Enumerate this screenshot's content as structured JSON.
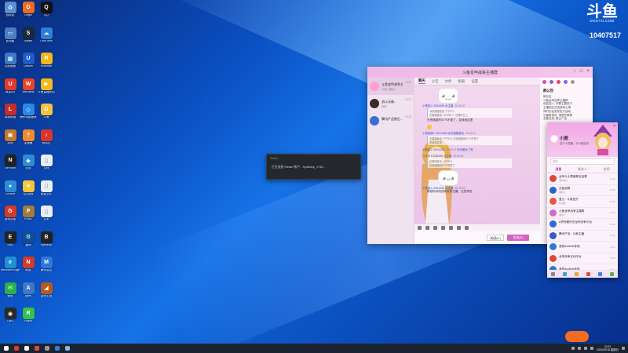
{
  "brand": {
    "logo": "斗鱼",
    "logo_sub": "DOUYU.COM",
    "room_id": "10407517",
    "accent": "#f36b20"
  },
  "desktop_icons": [
    {
      "label": "回收站",
      "color": "#5b8fd1",
      "glyph": "♻"
    },
    {
      "label": "Origin",
      "color": "#f06a1f",
      "glyph": "O"
    },
    {
      "label": "QQ",
      "color": "#111",
      "glyph": "Q"
    },
    {
      "label": "此电脑",
      "color": "#4b7fc2",
      "glyph": "▭"
    },
    {
      "label": "Steam",
      "color": "#1b2838",
      "glyph": "S"
    },
    {
      "label": "OneDrive",
      "color": "#2d7fd6",
      "glyph": "☁"
    },
    {
      "label": "控制面板",
      "color": "#3a78c8",
      "glyph": "▦"
    },
    {
      "label": "Ubisoft",
      "color": "#1d5cc7",
      "glyph": "U"
    },
    {
      "label": "Rockstar",
      "color": "#f1b61c",
      "glyph": "R"
    },
    {
      "label": "网易UU",
      "color": "#e23b2f",
      "glyph": "U"
    },
    {
      "label": "WeGame",
      "color": "#e8442a",
      "glyph": "W"
    },
    {
      "label": "斗鱼直播伴侣",
      "color": "#f4b81e",
      "glyph": "▶"
    },
    {
      "label": "英雄联盟",
      "color": "#c62c2c",
      "glyph": "L"
    },
    {
      "label": "腾讯电脑管家",
      "color": "#2a88e8",
      "glyph": "◇"
    },
    {
      "label": "斗鱼",
      "color": "#f6c23a",
      "glyph": "D"
    },
    {
      "label": "游戏",
      "color": "#c47a2b",
      "glyph": "▣"
    },
    {
      "label": "加速器",
      "color": "#f28a2b",
      "glyph": "?"
    },
    {
      "label": "网易云",
      "color": "#d9362b",
      "glyph": "♪"
    },
    {
      "label": "GeForce",
      "color": "#222",
      "glyph": "N"
    },
    {
      "label": "应用",
      "color": "#2f8bd6",
      "glyph": "◆"
    },
    {
      "label": "文档",
      "color": "#e9eef5",
      "glyph": "▯"
    },
    {
      "label": "Chrome",
      "color": "#2f8bd6",
      "glyph": "●"
    },
    {
      "label": "QQ游戏",
      "color": "#f6c73a",
      "glyph": "★"
    },
    {
      "label": "新建文件",
      "color": "#e9eef5",
      "glyph": "▯"
    },
    {
      "label": "游戏加加",
      "color": "#d33a2a",
      "glyph": "G"
    },
    {
      "label": "PUBG",
      "color": "#a47b3a",
      "glyph": "P"
    },
    {
      "label": "文本",
      "color": "#e9eef5",
      "glyph": "▯"
    },
    {
      "label": "Epic",
      "color": "#222",
      "glyph": "E"
    },
    {
      "label": "雷神",
      "color": "#0e4e94",
      "glyph": "⚙"
    },
    {
      "label": "Bandizip",
      "color": "#222",
      "glyph": "B"
    },
    {
      "label": "Microsoft Edge",
      "color": "#1f8fd6",
      "glyph": "e"
    },
    {
      "label": "网易",
      "color": "#d33a2a",
      "glyph": "N"
    },
    {
      "label": "腾讯会议",
      "color": "#2f78d8",
      "glyph": "M"
    },
    {
      "label": "微信",
      "color": "#2bb14b",
      "glyph": "✉"
    },
    {
      "label": "Apex",
      "color": "#4176c8",
      "glyph": "A"
    },
    {
      "label": "游戏平台",
      "color": "#b85a1e",
      "glyph": "◢"
    },
    {
      "label": "OBS",
      "color": "#2a2a2a",
      "glyph": "◉"
    },
    {
      "label": "Razer",
      "color": "#33c24a",
      "glyph": "R"
    }
  ],
  "steam_popup": {
    "title": "Steam",
    "message": "正在连接 Steam 帐户：bydsktop_1745..."
  },
  "qq_window": {
    "title": "斗鱼龙甲战争主播群",
    "conversations": [
      {
        "name": "斗鱼龙甲战争主...",
        "preview": "斗鱼: [图片]",
        "time": "20:49"
      },
      {
        "name": "战斗无敌...",
        "preview": "你好",
        "time": "19:21"
      },
      {
        "name": "腾讯产品售后...",
        "preview": "...",
        "time": "15:30"
      }
    ],
    "tabs": [
      "聊天",
      "公告",
      "文件",
      "相册",
      "设置"
    ],
    "messages": [
      {
        "from": "小黑鲨1 10914455",
        "tag": "@主播",
        "time": "20:45:37",
        "quote": [
          "@陈路路昔吞 宁宁ff+1",
          "在路路昔吞: 2015年了, 仿佛昨日上"
        ],
        "text": "白夜路路的5775不更了，发我我这里"
      },
      {
        "from": "小黑鲨鲜1 10914455",
        "tag": "@在路路昔吞",
        "time": "20:46:01",
        "quote": [
          "在路路昔吞: 宁宁ff+1 白夜路路的5775不更了",
          "发我我这里"
        ],
        "text": ""
      },
      {
        "from": "小黑鲨1 10914455",
        "tag": "",
        "time": "20:46:07",
        "quote": [],
        "text": "你也哪木了呢"
      },
      {
        "from": "以东W 10288188",
        "tag": "@主播",
        "time": "20:49:09",
        "quote": [
          "在路路昔吞: 宁宁ff+1",
          "白夜路路的5775不更了"
        ],
        "text": ""
      },
      {
        "from": "小黑鲨1 10914455",
        "tag": "@主播",
        "time": "20:49:09",
        "quote": [],
        "text": "麻烦你你改成你实的位置，注意排查"
      }
    ],
    "close_label": "关闭(C)",
    "send_label": "发送(S)",
    "notice_title": "群公告",
    "notice_heading": "群公告",
    "notice_body": [
      "新社区",
      "斗鱼龙甲战争主播群",
      "欢迎加入, 本群主要用于",
      "主播相互交流游戏心得",
      "同时也会发布官方活动",
      "与最新资讯, 请遵守群规",
      "友善交流, 禁止广告"
    ]
  },
  "qq_panel": {
    "nickname": "小鹿",
    "signature": "这个人很懒，什么都没写",
    "search_placeholder": "搜索",
    "tabs": [
      "消息",
      "联系人",
      "空间"
    ],
    "items": [
      {
        "name": "龙甲斗士群组联合加群",
        "preview": "[群消息]",
        "time": "21:09",
        "color": "#e2443a"
      },
      {
        "name": "无敌战群",
        "preview": "[图片]",
        "time": "20:56",
        "color": "#2d64c9"
      },
      {
        "name": "爱公 · 斗鱼官方",
        "preview": "新消息",
        "time": "20:50",
        "color": "#e7563f"
      },
      {
        "name": "斗鱼龙甲战争主播群",
        "preview": "[图片]",
        "time": "20:49",
        "color": "#d36cc2"
      },
      {
        "name": "A拼完都外在龙甲战争平台",
        "preview": "...",
        "time": "20:46",
        "color": "#2a6cd8"
      },
      {
        "name": "腾讯产品 · 斗鱼主播",
        "preview": "...",
        "time": "20:32",
        "color": "#3a58c8"
      },
      {
        "name": "我的Android手机",
        "preview": "",
        "time": "19:41",
        "color": "#2f78d8"
      },
      {
        "name": "龙甲战争互动平台",
        "preview": "...",
        "time": "18:59",
        "color": "#e04a33"
      },
      {
        "name": "我的Android手机",
        "preview": "",
        "time": "18:22",
        "color": "#2f78d8"
      },
      {
        "name": "斗鱼龙甲战争宣传的游戏平台",
        "preview": "...",
        "time": "17:04",
        "color": "#3a7de0"
      }
    ]
  },
  "taskbar": {
    "time": "21:01",
    "date": "2022/10/16 星期日"
  }
}
